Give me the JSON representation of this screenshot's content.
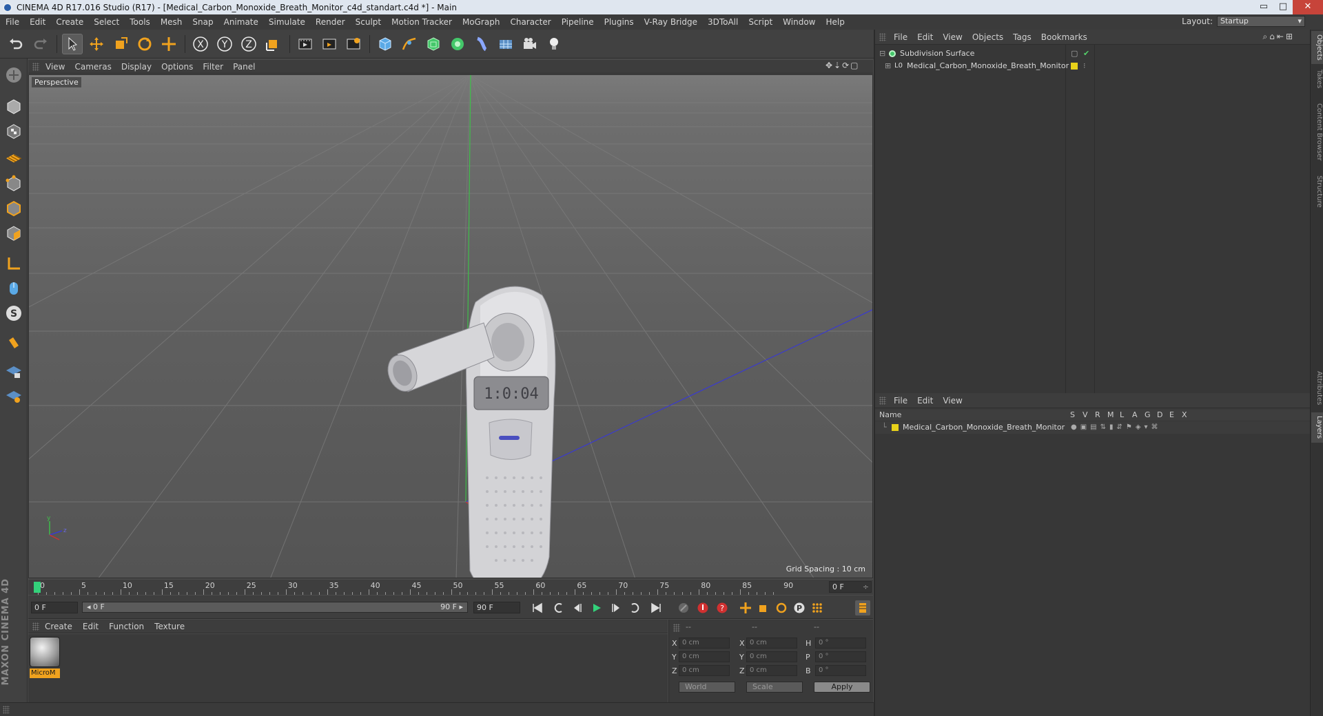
{
  "window": {
    "title": "CINEMA 4D R17.016 Studio (R17) - [Medical_Carbon_Monoxide_Breath_Monitor_c4d_standart.c4d *] - Main",
    "buttons": [
      "▭",
      "□",
      "✕"
    ]
  },
  "menubar": {
    "items": [
      "File",
      "Edit",
      "Create",
      "Select",
      "Tools",
      "Mesh",
      "Snap",
      "Animate",
      "Simulate",
      "Render",
      "Sculpt",
      "Motion Tracker",
      "MoGraph",
      "Character",
      "Pipeline",
      "Plugins",
      "V-Ray Bridge",
      "3DToAll",
      "Script",
      "Window",
      "Help"
    ],
    "layout_label": "Layout:",
    "layout_value": "Startup"
  },
  "viewport": {
    "menu": [
      "View",
      "Cameras",
      "Display",
      "Options",
      "Filter",
      "Panel"
    ],
    "label": "Perspective",
    "grid_spacing": "Grid Spacing : 10 cm",
    "display_digits": "1:0:04",
    "axis_y": "y",
    "axis_z": "z"
  },
  "timeline": {
    "ticks": [
      "0",
      "5",
      "10",
      "15",
      "20",
      "25",
      "30",
      "35",
      "40",
      "45",
      "50",
      "55",
      "60",
      "65",
      "70",
      "75",
      "80",
      "85",
      "90"
    ],
    "current_frame": "0 F",
    "start_field": "0 F",
    "range_start": "◂ 0 F",
    "range_end": "90 F ▸",
    "end_field": "90 F"
  },
  "material": {
    "menu": [
      "Create",
      "Edit",
      "Function",
      "Texture"
    ],
    "name": "MicroM"
  },
  "coordinates": {
    "headers": [
      "--",
      "--",
      "--"
    ],
    "rows": [
      {
        "axis": "X",
        "pos": "0 cm",
        "axis2": "X",
        "size": "0 cm",
        "rot_axis": "H",
        "rot": "0 °"
      },
      {
        "axis": "Y",
        "pos": "0 cm",
        "axis2": "Y",
        "size": "0 cm",
        "rot_axis": "P",
        "rot": "0 °"
      },
      {
        "axis": "Z",
        "pos": "0 cm",
        "axis2": "Z",
        "size": "0 cm",
        "rot_axis": "B",
        "rot": "0 °"
      }
    ],
    "world": "World",
    "scale": "Scale",
    "apply": "Apply"
  },
  "objects": {
    "menu": [
      "File",
      "Edit",
      "View",
      "Objects",
      "Tags",
      "Bookmarks"
    ],
    "items": [
      {
        "name": "Subdivision Surface"
      },
      {
        "name": "Medical_Carbon_Monoxide_Breath_Monitor"
      }
    ]
  },
  "layers": {
    "menu": [
      "File",
      "Edit",
      "View"
    ],
    "columns": [
      "Name",
      "S",
      "V",
      "R",
      "M",
      "L",
      "A",
      "G",
      "D",
      "E",
      "X"
    ],
    "items": [
      {
        "name": "Medical_Carbon_Monoxide_Breath_Monitor"
      }
    ]
  },
  "side_tabs": [
    "Objects",
    "Takes",
    "Content Browser",
    "Structure",
    "Attributes",
    "Layers"
  ],
  "branding": "MAXON CINEMA 4D",
  "colors": {
    "accent_orange": "#f0a21e",
    "layer_yellow": "#e8d21a",
    "axis_green": "#33cc44",
    "axis_blue": "#3a3ad0",
    "axis_red": "#cc3333"
  }
}
